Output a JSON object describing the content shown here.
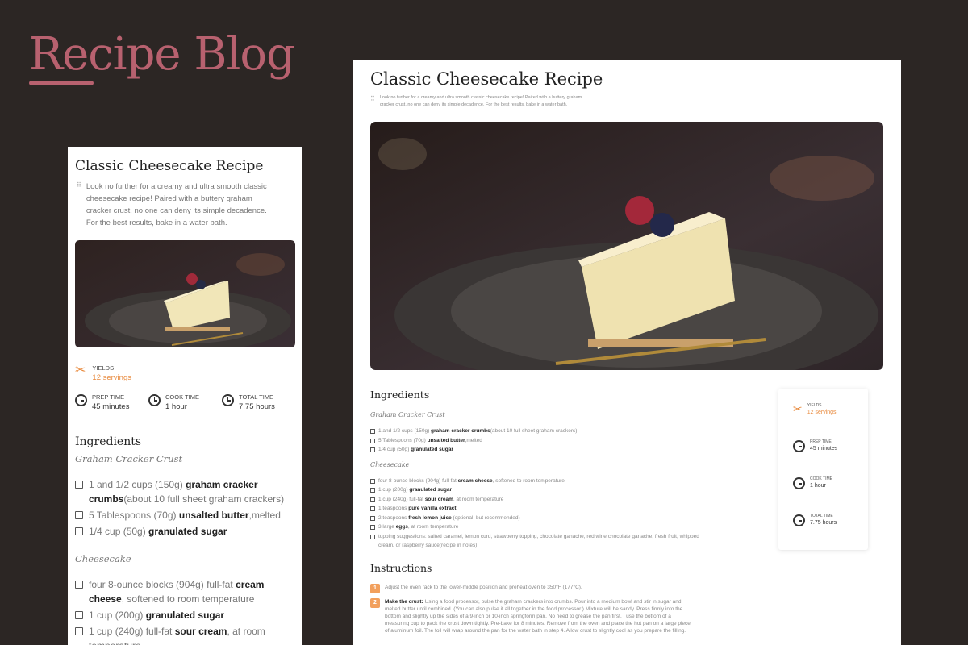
{
  "brand": {
    "title": "Recipe Blog"
  },
  "recipe": {
    "title": "Classic Cheesecake Recipe",
    "description": "Look no further for a creamy and ultra smooth classic cheesecake recipe! Paired with a buttery graham cracker crust, no one can deny its simple decadence. For the best results, bake in a water bath.",
    "yields_label": "YIELDS",
    "yields_value": "12 servings",
    "times": [
      {
        "label": "PREP TIME",
        "value": "45 minutes"
      },
      {
        "label": "COOK TIME",
        "value": "1 hour"
      },
      {
        "label": "TOTAL TIME",
        "value": "7.75 hours"
      }
    ]
  },
  "ingredients": {
    "heading": "Ingredients",
    "crust_heading": "Graham Cracker Crust",
    "crust_items": [
      {
        "pre": "1 and 1/2 cups (150g) ",
        "bold": "graham cracker crumbs",
        "post": "(about 10 full sheet graham crackers)"
      },
      {
        "pre": "5 Tablespoons (70g) ",
        "bold": "unsalted butter",
        "post": ",melted"
      },
      {
        "pre": "1/4 cup (50g) ",
        "bold": "granulated sugar",
        "post": ""
      }
    ],
    "filling_heading": "Cheesecake",
    "filling_items": [
      {
        "pre": "four 8-ounce blocks (904g) full-fat ",
        "bold": "cream cheese",
        "post": ", softened to room temperature"
      },
      {
        "pre": "1 cup (200g) ",
        "bold": "granulated sugar",
        "post": ""
      },
      {
        "pre": "1 cup (240g) full-fat ",
        "bold": "sour cream",
        "post": ", at room temperature"
      },
      {
        "pre": "1 teaspoons ",
        "bold": "pure vanilla extract",
        "post": ""
      },
      {
        "pre": "2 teaspoons ",
        "bold": "fresh lemon juice",
        "post": " (optional, but recommended)"
      },
      {
        "pre": "3 large ",
        "bold": "eggs",
        "post": ", at room temperature"
      },
      {
        "pre": "topping suggestions: salted caramel, lemon curd, strawberry topping, chocolate ganache, red wine chocolate ganache, fresh fruit, whipped cream, or raspberry sauce(recipe in notes)",
        "bold": "",
        "post": ""
      }
    ]
  },
  "instructions": {
    "heading": "Instructions",
    "steps": [
      {
        "num": "1",
        "bold": "",
        "text": "Adjust the oven rack to the lower-middle position and preheat oven to 350°F (177°C)."
      },
      {
        "num": "2",
        "bold": "Make the crust:",
        "text": " Using a food processor, pulse the graham crackers into crumbs. Pour into a medium bowl and stir in sugar and melted butter until combined. (You can also pulse it all together in the food processor.) Mixture will be sandy. Press firmly into the bottom and slightly up the sides of a 9-inch or 10-inch springform pan. No need to grease the pan first. I use the bottom of a measuring cup to pack the crust down tightly. Pre-bake for 8 minutes. Remove from the oven and place the hot pan on a large piece of aluminum foil. The foil will wrap around the pan for the water bath in step 4. Allow crust to slightly cool as you prepare the filling."
      }
    ]
  }
}
